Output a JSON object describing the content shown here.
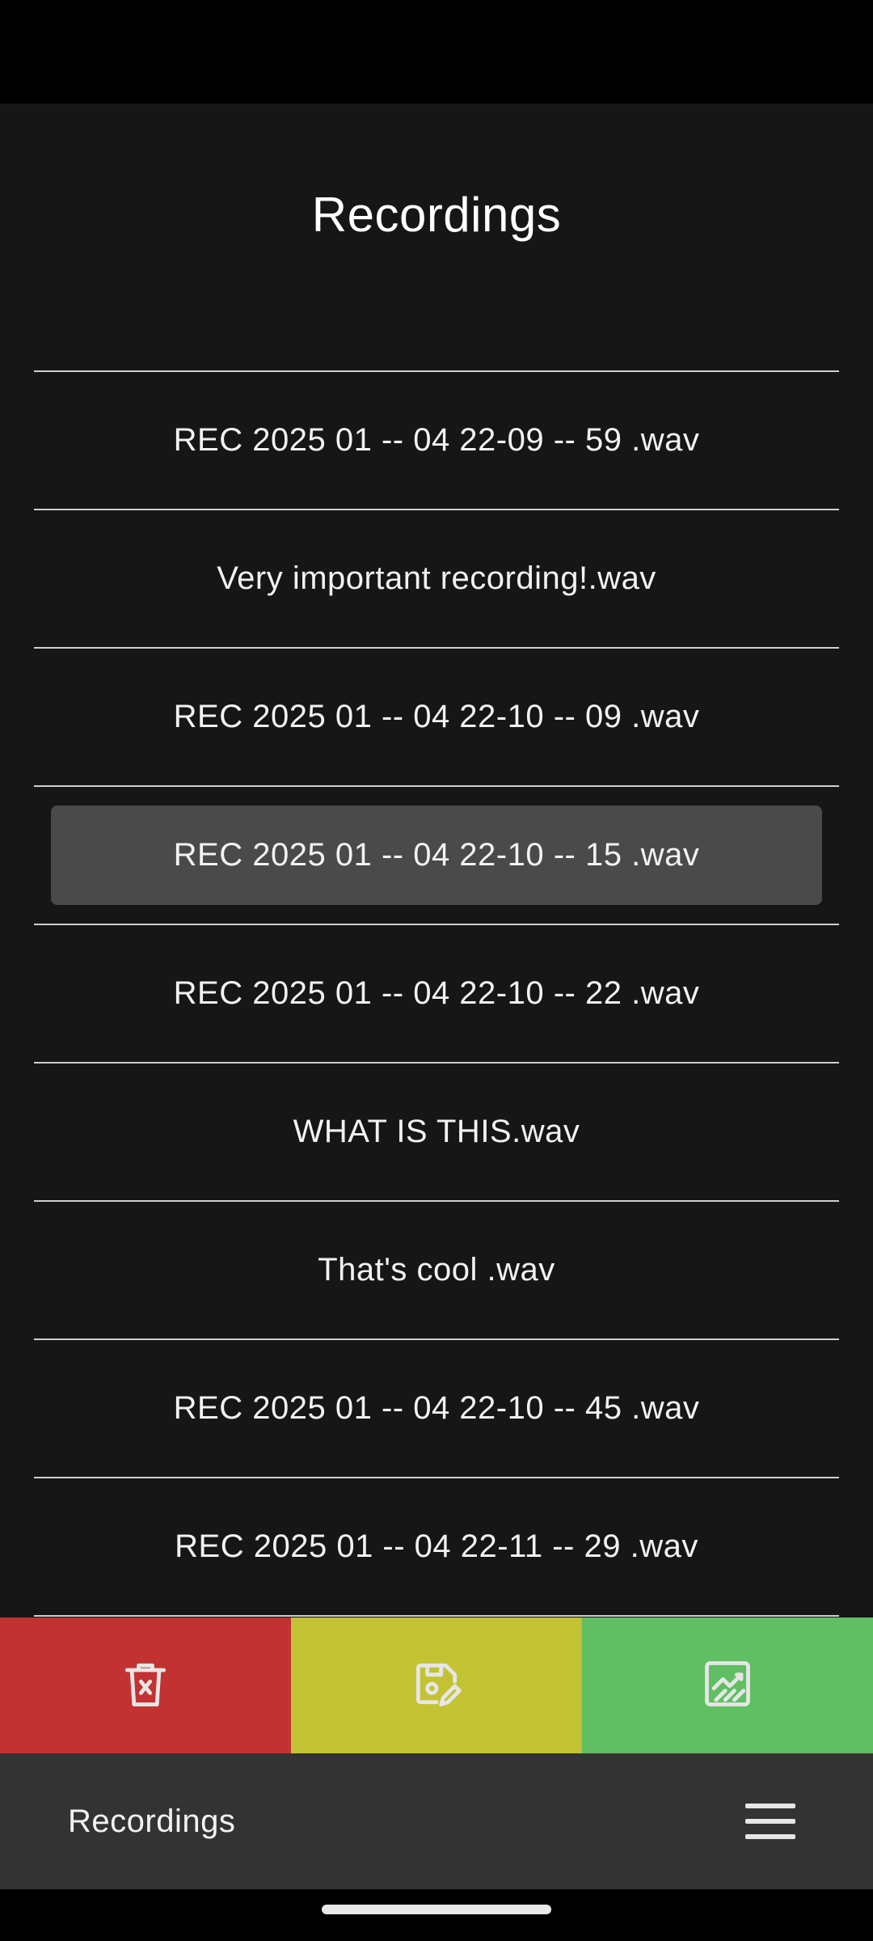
{
  "header": {
    "title": "Recordings"
  },
  "recordings": [
    {
      "name": "REC 2025 01 -- 04 22-09 -- 59 .wav"
    },
    {
      "name": "Very important recording!.wav"
    },
    {
      "name": "REC 2025 01 -- 04 22-10 -- 09 .wav"
    },
    {
      "name": "REC 2025 01 -- 04 22-10 -- 15 .wav",
      "selected": true
    },
    {
      "name": "REC 2025 01 -- 04 22-10 -- 22 .wav"
    },
    {
      "name": "WHAT IS THIS.wav"
    },
    {
      "name": "That's cool .wav"
    },
    {
      "name": "REC 2025 01 -- 04 22-10 -- 45 .wav"
    },
    {
      "name": "REC 2025 01 -- 04 22-11 -- 29 .wav"
    }
  ],
  "actions": [
    {
      "name": "delete",
      "icon": "trash-x-icon",
      "color": "#c23232"
    },
    {
      "name": "save-edit",
      "icon": "save-edit-icon",
      "color": "#c3c232"
    },
    {
      "name": "chart",
      "icon": "chart-icon",
      "color": "#5fbf62"
    }
  ],
  "bottom_nav": {
    "title": "Recordings",
    "menu_icon": "hamburger-menu-icon"
  },
  "colors": {
    "background": "#161616",
    "selected_row": "#4a4a4a",
    "divider": "#cfcfcf",
    "nav_background": "#333333"
  }
}
